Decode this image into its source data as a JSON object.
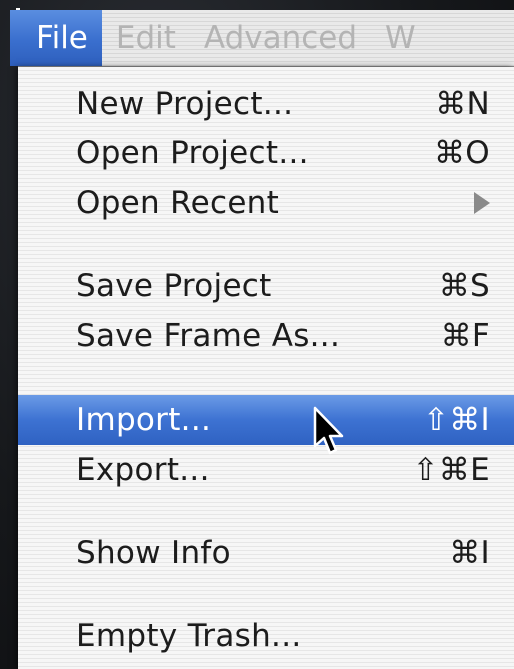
{
  "menubar": {
    "items": [
      {
        "label": "File",
        "active": true
      },
      {
        "label": "Edit",
        "active": false
      },
      {
        "label": "Advanced",
        "active": false
      },
      {
        "label": "W",
        "active": false
      }
    ]
  },
  "file_menu": {
    "items": [
      {
        "label": "New Project...",
        "shortcut": "⌘N"
      },
      {
        "label": "Open Project...",
        "shortcut": "⌘O"
      },
      {
        "label": "Open Recent",
        "submenu": true
      },
      {
        "label": "Save Project",
        "shortcut": "⌘S"
      },
      {
        "label": "Save Frame As...",
        "shortcut": "⌘F"
      },
      {
        "label": "Import...",
        "shortcut": "⇧⌘I",
        "highlighted": true
      },
      {
        "label": "Export...",
        "shortcut": "⇧⌘E"
      },
      {
        "label": "Show Info",
        "shortcut": "⌘I"
      },
      {
        "label": "Empty Trash..."
      }
    ]
  },
  "colors": {
    "highlight": "#3d72d2",
    "menu_text": "#1c1c1c",
    "disabled_text": "#b4b4b4"
  }
}
